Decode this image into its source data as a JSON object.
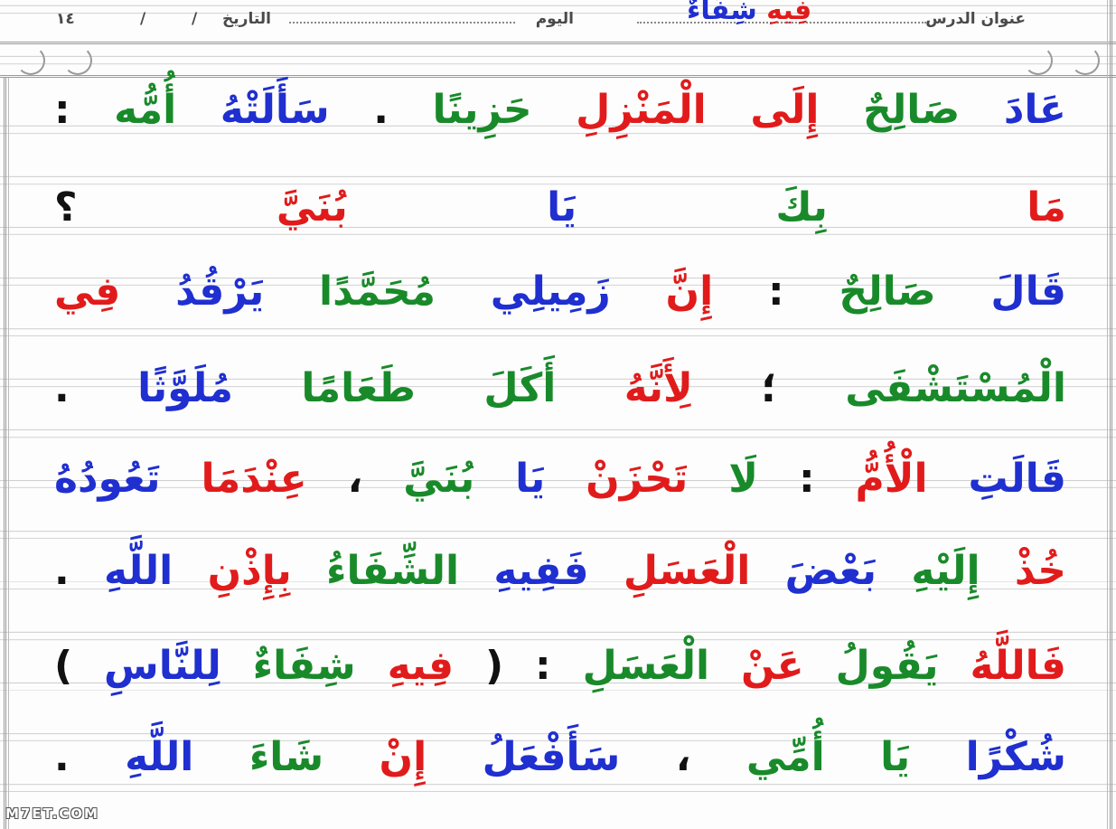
{
  "header": {
    "lesson_label": "عنوان الدرس",
    "day_label": "اليوم",
    "date_label": "التاريخ",
    "slash": "/",
    "number": "١٤"
  },
  "lesson_title": {
    "words": [
      {
        "text": "فِيهِ",
        "color": "#e11b1b"
      },
      {
        "text": " "
      },
      {
        "text": "شِفَاءٌ",
        "color": "#1f2fd0"
      }
    ]
  },
  "lines": [
    [
      {
        "text": "عَادَ",
        "color": "#1f2fd0"
      },
      {
        "text": "صَالِحٌ",
        "color": "#198a2a"
      },
      {
        "text": "إِلَى",
        "color": "#e11b1b"
      },
      {
        "text": "الْمَنْزِلِ",
        "color": "#e11b1b"
      },
      {
        "text": "حَزِينًا",
        "color": "#198a2a"
      },
      {
        "text": ".",
        "color": "#111111"
      },
      {
        "text": "سَأَلَتْهُ",
        "color": "#1f2fd0"
      },
      {
        "text": "أُمُّه",
        "color": "#198a2a"
      },
      {
        "text": ":",
        "color": "#111111"
      }
    ],
    [
      {
        "text": "مَا",
        "color": "#e11b1b"
      },
      {
        "text": "بِكَ",
        "color": "#198a2a"
      },
      {
        "text": "يَا",
        "color": "#1f2fd0"
      },
      {
        "text": "بُنَيَّ",
        "color": "#e11b1b"
      },
      {
        "text": "؟",
        "color": "#111111"
      }
    ],
    [
      {
        "text": "قَالَ",
        "color": "#1f2fd0"
      },
      {
        "text": "صَالِحٌ",
        "color": "#198a2a"
      },
      {
        "text": ":",
        "color": "#111111"
      },
      {
        "text": "إِنَّ",
        "color": "#e11b1b"
      },
      {
        "text": "زَمِيلِي",
        "color": "#1f2fd0"
      },
      {
        "text": "مُحَمَّدًا",
        "color": "#198a2a"
      },
      {
        "text": "يَرْقُدُ",
        "color": "#1f2fd0"
      },
      {
        "text": "فِي",
        "color": "#e11b1b"
      }
    ],
    [
      {
        "text": "الْمُسْتَشْفَى",
        "color": "#198a2a"
      },
      {
        "text": "؛",
        "color": "#111111"
      },
      {
        "text": "لِأَنَّهُ",
        "color": "#e11b1b"
      },
      {
        "text": "أَكَلَ",
        "color": "#198a2a"
      },
      {
        "text": "طَعَامًا",
        "color": "#198a2a"
      },
      {
        "text": "مُلَوَّثًا",
        "color": "#1f2fd0"
      },
      {
        "text": ".",
        "color": "#111111"
      }
    ],
    [
      {
        "text": "قَالَتِ",
        "color": "#1f2fd0"
      },
      {
        "text": "الْأُمُّ",
        "color": "#e11b1b"
      },
      {
        "text": ":",
        "color": "#111111"
      },
      {
        "text": "لَا",
        "color": "#198a2a"
      },
      {
        "text": "تَحْزَنْ",
        "color": "#e11b1b"
      },
      {
        "text": "يَا",
        "color": "#1f2fd0"
      },
      {
        "text": "بُنَيَّ",
        "color": "#198a2a"
      },
      {
        "text": "،",
        "color": "#111111"
      },
      {
        "text": "عِنْدَمَا",
        "color": "#e11b1b"
      },
      {
        "text": "تَعُودُهُ",
        "color": "#1f2fd0"
      }
    ],
    [
      {
        "text": "خُذْ",
        "color": "#e11b1b"
      },
      {
        "text": "إِلَيْهِ",
        "color": "#198a2a"
      },
      {
        "text": "بَعْضَ",
        "color": "#1f2fd0"
      },
      {
        "text": "الْعَسَلِ",
        "color": "#e11b1b"
      },
      {
        "text": "فَفِيهِ",
        "color": "#1f2fd0"
      },
      {
        "text": "الشِّفَاءُ",
        "color": "#198a2a"
      },
      {
        "text": "بِإِذْنِ",
        "color": "#e11b1b"
      },
      {
        "text": "اللَّهِ",
        "color": "#1f2fd0"
      },
      {
        "text": ".",
        "color": "#111111"
      }
    ],
    [
      {
        "text": "فَاللَّهُ",
        "color": "#e11b1b"
      },
      {
        "text": "يَقُولُ",
        "color": "#198a2a"
      },
      {
        "text": "عَنْ",
        "color": "#e11b1b"
      },
      {
        "text": "الْعَسَلِ",
        "color": "#198a2a"
      },
      {
        "text": ":",
        "color": "#111111"
      },
      {
        "text": "(",
        "color": "#111111"
      },
      {
        "text": "فِيهِ",
        "color": "#e11b1b"
      },
      {
        "text": "شِفَاءٌ",
        "color": "#198a2a"
      },
      {
        "text": "لِلنَّاسِ",
        "color": "#1f2fd0"
      },
      {
        "text": ")",
        "color": "#111111"
      }
    ],
    [
      {
        "text": "شُكْرًا",
        "color": "#1f2fd0"
      },
      {
        "text": "يَا",
        "color": "#198a2a"
      },
      {
        "text": "أُمِّي",
        "color": "#198a2a"
      },
      {
        "text": "،",
        "color": "#111111"
      },
      {
        "text": "سَأَفْعَلُ",
        "color": "#1f2fd0"
      },
      {
        "text": "إِنْ",
        "color": "#e11b1b"
      },
      {
        "text": "شَاءَ",
        "color": "#198a2a"
      },
      {
        "text": "اللَّهِ",
        "color": "#1f2fd0"
      },
      {
        "text": ".",
        "color": "#111111"
      }
    ]
  ],
  "watermark": "M7ET.COM"
}
